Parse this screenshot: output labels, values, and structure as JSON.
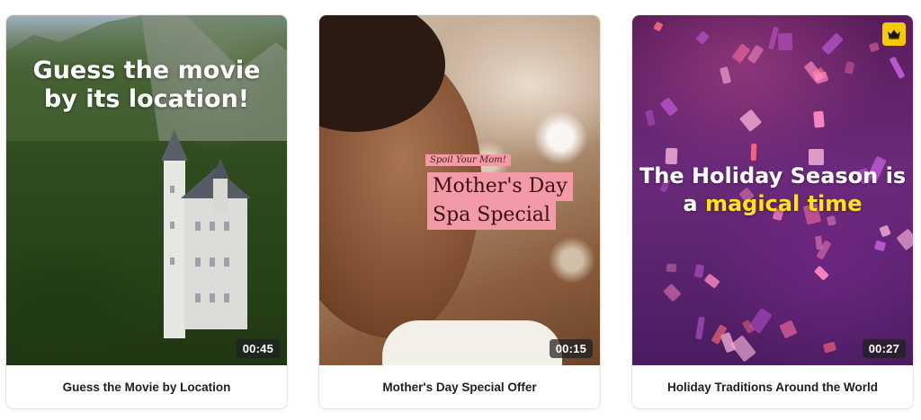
{
  "cards": [
    {
      "caption": "Guess the Movie by Location",
      "headline": "Guess the movie by its location!",
      "duration": "00:45"
    },
    {
      "caption": "Mother's Day Special Offer",
      "tagline": "Spoil Your Mom!",
      "headline_line1": "Mother's Day",
      "headline_line2": "Spa Special",
      "duration": "00:15"
    },
    {
      "caption": "Holiday Traditions Around the World",
      "headline_part1": "The Holiday Season is a ",
      "headline_highlight": "magical time",
      "duration": "00:27",
      "premium_icon": "crown-icon"
    }
  ],
  "colors": {
    "promo_pink": "#f29aa6",
    "highlight_yellow": "#ffe21a",
    "crown_badge": "#f7c900"
  }
}
